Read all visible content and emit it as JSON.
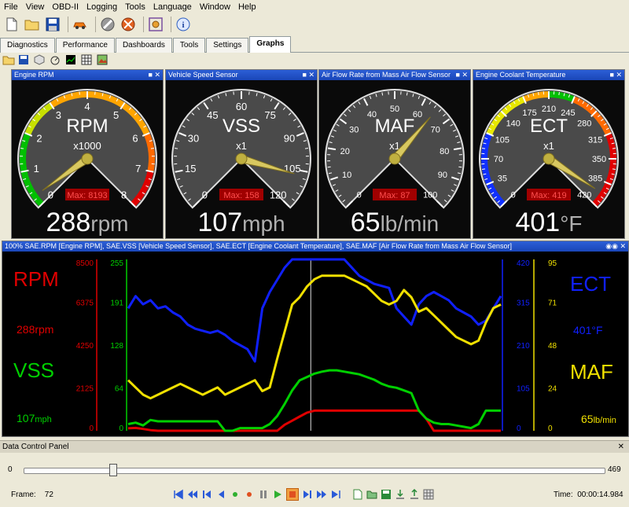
{
  "menu": [
    "File",
    "View",
    "OBD-II",
    "Logging",
    "Tools",
    "Language",
    "Window",
    "Help"
  ],
  "toolbar_icons": [
    "new-file-icon",
    "open-folder-icon",
    "save-icon",
    "car-icon",
    "wrench-icon",
    "tools-icon",
    "target-icon",
    "info-icon"
  ],
  "tabs": [
    {
      "label": "Diagnostics",
      "active": false
    },
    {
      "label": "Performance",
      "active": false
    },
    {
      "label": "Dashboards",
      "active": false
    },
    {
      "label": "Tools",
      "active": false
    },
    {
      "label": "Settings",
      "active": false
    },
    {
      "label": "Graphs",
      "active": true
    }
  ],
  "gauges": [
    {
      "title": "Engine RPM",
      "label": "RPM",
      "multiplier": "x1000",
      "ticks": [
        "0",
        "1",
        "2",
        "3",
        "4",
        "5",
        "6",
        "7",
        "8"
      ],
      "min": 0,
      "max": 8,
      "value_scaled": 0.288,
      "max_label": "Max: 8193",
      "readout_value": "288",
      "readout_unit": "rpm",
      "bands": [
        {
          "from": 0,
          "to": 2,
          "color": "#00c000"
        },
        {
          "from": 2,
          "to": 3,
          "color": "#c8e000"
        },
        {
          "from": 3,
          "to": 6,
          "color": "#ffa500"
        },
        {
          "from": 6,
          "to": 7,
          "color": "#ff6a00"
        },
        {
          "from": 7,
          "to": 8,
          "color": "#e00000"
        }
      ]
    },
    {
      "title": "Vehicle Speed Sensor",
      "label": "VSS",
      "multiplier": "x1",
      "ticks": [
        "0",
        "15",
        "30",
        "45",
        "60",
        "75",
        "90",
        "105",
        "120"
      ],
      "min": 0,
      "max": 120,
      "value_scaled": 107,
      "max_label": "Max: 158",
      "readout_value": "107",
      "readout_unit": "mph",
      "bands": []
    },
    {
      "title": "Air Flow Rate from Mass Air Flow Sensor",
      "label": "MAF",
      "multiplier": "x1",
      "ticks": [
        "0",
        "10",
        "20",
        "30",
        "40",
        "50",
        "60",
        "70",
        "80",
        "90",
        "100"
      ],
      "min": 0,
      "max": 100,
      "value_scaled": 65,
      "max_label": "Max: 87",
      "readout_value": "65",
      "readout_unit": "lb/min",
      "bands": []
    },
    {
      "title": "Engine Coolant Temperature",
      "label": "ECT",
      "multiplier": "x1",
      "ticks": [
        "0",
        "35",
        "70",
        "105",
        "140",
        "175",
        "210",
        "245",
        "280",
        "315",
        "350",
        "385",
        "420"
      ],
      "min": 0,
      "max": 420,
      "value_scaled": 401,
      "max_label": "Max: 419",
      "readout_value": "401",
      "readout_unit": "°F",
      "bands": [
        {
          "from": 0,
          "to": 105,
          "color": "#1030ff"
        },
        {
          "from": 105,
          "to": 175,
          "color": "#e8e800"
        },
        {
          "from": 175,
          "to": 210,
          "color": "#ffa500"
        },
        {
          "from": 210,
          "to": 245,
          "color": "#00c000"
        },
        {
          "from": 245,
          "to": 315,
          "color": "#ff6a00"
        },
        {
          "from": 315,
          "to": 420,
          "color": "#e00000"
        }
      ]
    }
  ],
  "graph": {
    "title": "100% SAE.RPM [Engine RPM], SAE.VSS [Vehicle Speed Sensor], SAE.ECT [Engine Coolant Temperature], SAE.MAF [Air Flow Rate from Mass Air Flow Sensor]",
    "left_labels": [
      {
        "name": "RPM",
        "value": "288rpm",
        "value_num": "288",
        "value_unit": "rpm",
        "color": "#e00000"
      },
      {
        "name": "VSS",
        "value": "107mph",
        "value_num": "107",
        "value_unit": "mph",
        "color": "#00d000"
      }
    ],
    "right_labels": [
      {
        "name": "ECT",
        "value": "401°F",
        "color": "#1020ff"
      },
      {
        "name": "MAF",
        "value": "65lb/min",
        "value_num": "65",
        "value_unit": "lb/min",
        "color": "#f0e000"
      }
    ],
    "rpm_axis": [
      "8500",
      "6375",
      "4250",
      "2125",
      "0"
    ],
    "vss_axis": [
      "255",
      "191",
      "128",
      "64",
      "0"
    ],
    "ect_axis": [
      "420",
      "315",
      "210",
      "105",
      "0"
    ],
    "maf_axis": [
      "95",
      "71",
      "48",
      "24",
      "0"
    ]
  },
  "chart_data": {
    "type": "line",
    "series": [
      {
        "name": "RPM",
        "color": "#e00000",
        "y": [
          120,
          140,
          90,
          30,
          0,
          0,
          0,
          0,
          0,
          0,
          0,
          0,
          0,
          0,
          0,
          0,
          0,
          0,
          0,
          0,
          0,
          300,
          500,
          700,
          900,
          1000,
          1000,
          1000,
          1000,
          1000,
          1000,
          1000,
          1000,
          1000,
          1000,
          1000,
          1000,
          1000,
          1000,
          1000,
          600,
          0,
          0,
          0,
          0,
          0,
          0,
          0,
          0,
          0,
          0
        ]
      },
      {
        "name": "VSS",
        "color": "#00d000",
        "y": [
          10,
          12,
          8,
          16,
          14,
          14,
          14,
          14,
          14,
          14,
          14,
          14,
          14,
          0,
          0,
          4,
          4,
          4,
          4,
          10,
          22,
          40,
          60,
          75,
          80,
          85,
          88,
          90,
          90,
          88,
          86,
          84,
          80,
          76,
          70,
          66,
          64,
          60,
          56,
          30,
          18,
          12,
          10,
          10,
          8,
          6,
          4,
          10,
          30,
          30,
          30
        ]
      },
      {
        "name": "ECT",
        "color": "#1020ff",
        "y": [
          300,
          330,
          310,
          320,
          300,
          305,
          290,
          280,
          260,
          250,
          245,
          240,
          245,
          235,
          220,
          210,
          200,
          170,
          300,
          340,
          370,
          400,
          420,
          420,
          420,
          420,
          420,
          420,
          420,
          420,
          400,
          380,
          370,
          360,
          355,
          350,
          300,
          280,
          260,
          310,
          330,
          340,
          330,
          320,
          300,
          290,
          280,
          260,
          270,
          300,
          330
        ]
      },
      {
        "name": "MAF",
        "color": "#f0e000",
        "y": [
          28,
          24,
          20,
          18,
          20,
          22,
          24,
          26,
          24,
          22,
          20,
          22,
          24,
          20,
          22,
          24,
          26,
          28,
          22,
          24,
          40,
          55,
          70,
          74,
          80,
          84,
          86,
          86,
          86,
          86,
          84,
          82,
          80,
          76,
          72,
          70,
          72,
          78,
          74,
          66,
          68,
          64,
          60,
          56,
          52,
          50,
          48,
          50,
          60,
          68,
          70
        ]
      }
    ]
  },
  "dcp": {
    "title": "Data Control Panel",
    "slider_min": "0",
    "slider_max": "469",
    "slider_position": 72,
    "frame_label": "Frame:",
    "frame_value": "72",
    "time_label": "Time:",
    "time_value": "00:00:14.984"
  }
}
